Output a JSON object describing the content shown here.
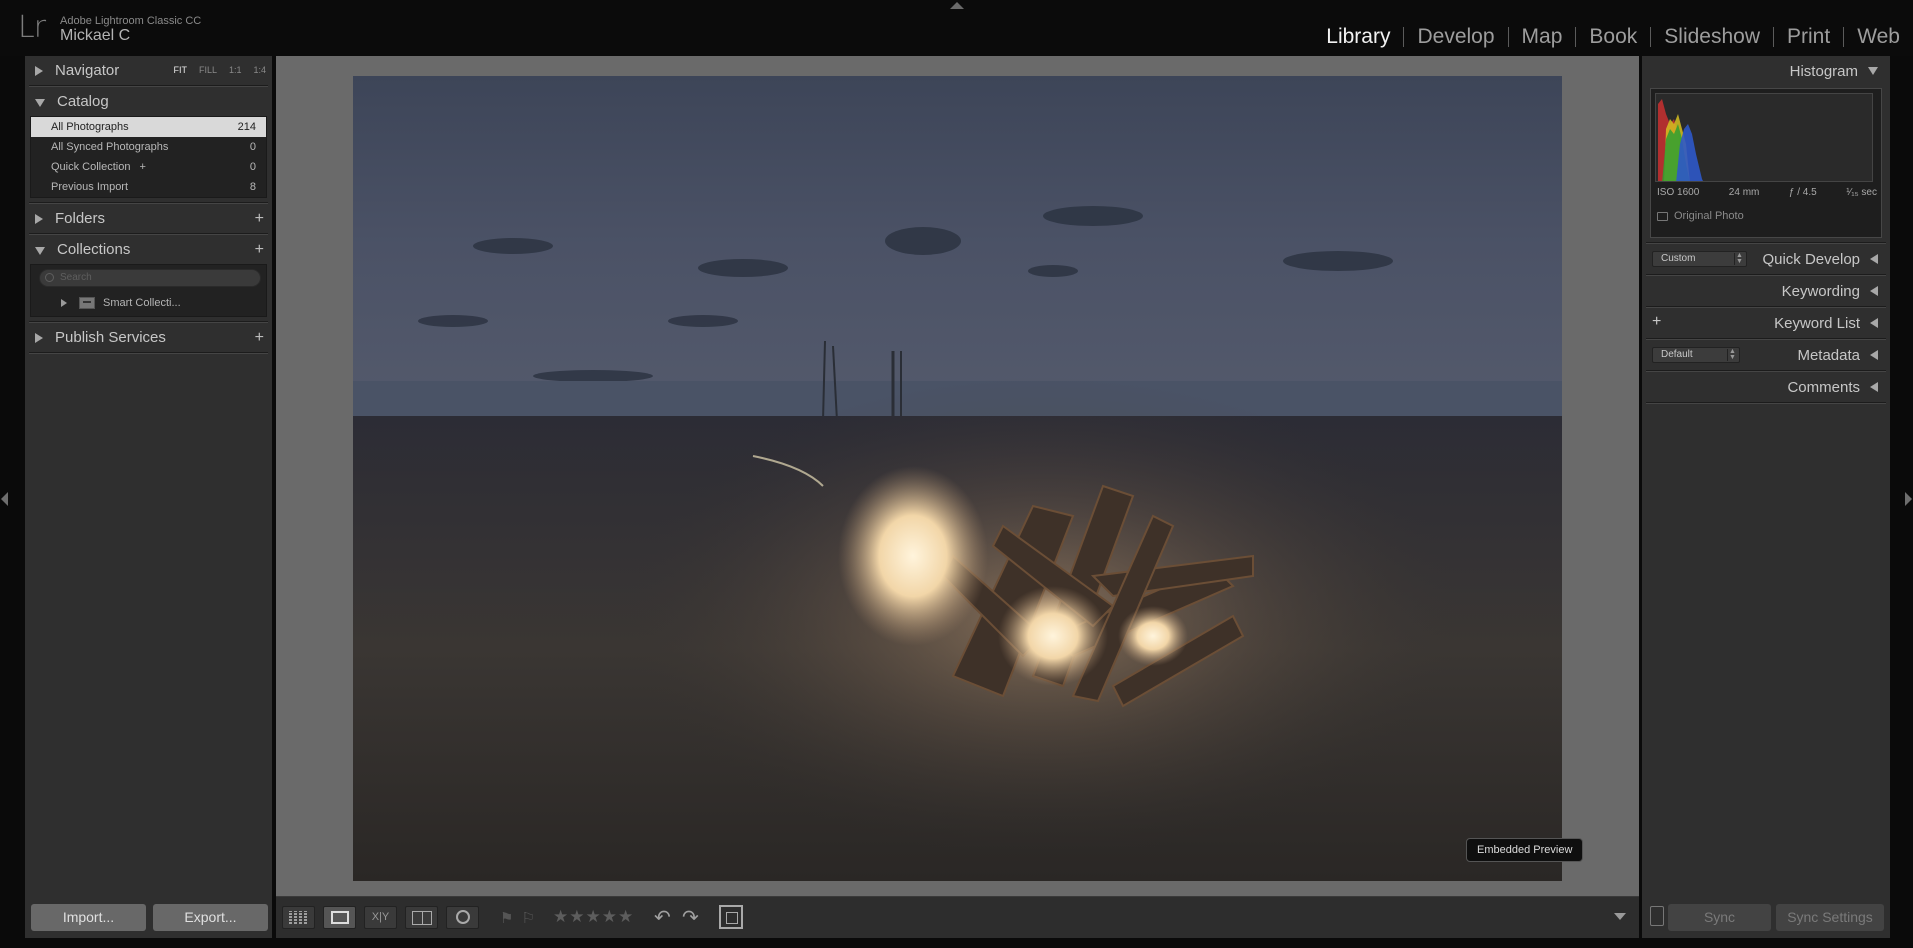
{
  "app": {
    "logo": "Lr",
    "name": "Adobe Lightroom Classic CC",
    "user": "Mickael C"
  },
  "modules": [
    {
      "label": "Library",
      "active": true
    },
    {
      "label": "Develop",
      "active": false
    },
    {
      "label": "Map",
      "active": false
    },
    {
      "label": "Book",
      "active": false
    },
    {
      "label": "Slideshow",
      "active": false
    },
    {
      "label": "Print",
      "active": false
    },
    {
      "label": "Web",
      "active": false
    }
  ],
  "left_panel": {
    "navigator": {
      "title": "Navigator",
      "zoom_options": [
        "FIT",
        "FILL",
        "1:1",
        "1:4"
      ],
      "zoom_selected": "FIT"
    },
    "catalog": {
      "title": "Catalog",
      "items": [
        {
          "label": "All Photographs",
          "count": "214",
          "selected": true
        },
        {
          "label": "All Synced Photographs",
          "count": "0",
          "selected": false
        },
        {
          "label": "Quick Collection",
          "suffix": "+",
          "count": "0",
          "selected": false
        },
        {
          "label": "Previous Import",
          "count": "8",
          "selected": false
        }
      ]
    },
    "folders": {
      "title": "Folders",
      "add": "+"
    },
    "collections": {
      "title": "Collections",
      "add": "+",
      "search_placeholder": "Search",
      "items": [
        {
          "label": "Smart Collecti..."
        }
      ]
    },
    "publish_services": {
      "title": "Publish Services",
      "add": "+"
    },
    "import_label": "Import...",
    "export_label": "Export..."
  },
  "center": {
    "preview_badge": "Embedded Preview",
    "image_icon": "photo-campfire-on-beach-at-dusk"
  },
  "toolbar": {
    "compare_label": "X|Y",
    "stars": "★★★★★",
    "flag_icons": [
      "flag-icon",
      "reject-flag-icon"
    ],
    "rotate_left": "↶",
    "rotate_right": "↷"
  },
  "right_panel": {
    "histogram": {
      "title": "Histogram",
      "iso": "ISO 1600",
      "focal": "24 mm",
      "aperture": "ƒ / 4.5",
      "shutter": "¹⁄₁₅ sec",
      "original_photo": "Original Photo"
    },
    "quick_develop": {
      "title": "Quick Develop",
      "preset": "Custom"
    },
    "keywording": {
      "title": "Keywording"
    },
    "keyword_list": {
      "title": "Keyword List",
      "add": "+"
    },
    "metadata": {
      "title": "Metadata",
      "preset": "Default"
    },
    "comments": {
      "title": "Comments"
    },
    "sync_label": "Sync",
    "sync_settings_label": "Sync Settings"
  },
  "colors": {
    "panel_bg": "#2f2f2f",
    "center_bg": "#6a6a6a",
    "top_bg": "#0b0b0b",
    "active_module": "#f2f2f2"
  }
}
